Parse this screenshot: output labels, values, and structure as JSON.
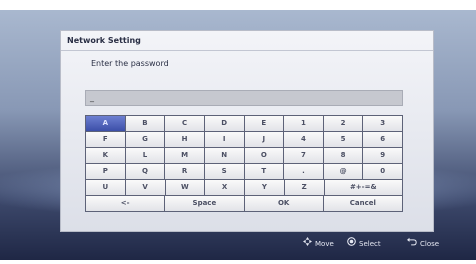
{
  "dialog": {
    "title": "Network Setting",
    "prompt": "Enter the password",
    "input_value": "_"
  },
  "keyboard": {
    "rows": [
      [
        "A",
        "B",
        "C",
        "D",
        "E",
        "1",
        "2",
        "3"
      ],
      [
        "F",
        "G",
        "H",
        "I",
        "J",
        "4",
        "5",
        "6"
      ],
      [
        "K",
        "L",
        "M",
        "N",
        "O",
        "7",
        "8",
        "9"
      ],
      [
        "P",
        "Q",
        "R",
        "S",
        "T",
        ".",
        "@",
        "0"
      ],
      [
        "U",
        "V",
        "W",
        "X",
        "Y",
        "Z",
        "#+-=&"
      ],
      [
        "<-",
        "Space",
        "OK",
        "Cancel"
      ]
    ],
    "selected_key": "A"
  },
  "footer": {
    "move_label": "Move",
    "select_label": "Select",
    "close_label": "Close",
    "move_icon": "dpad-icon",
    "select_icon": "enter-button-icon",
    "close_icon": "return-icon"
  }
}
